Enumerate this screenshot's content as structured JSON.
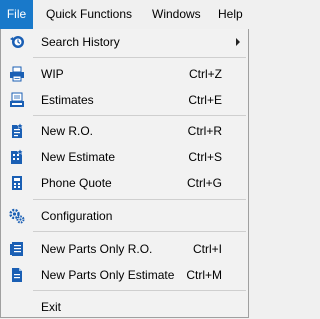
{
  "menubar": {
    "file": "File",
    "quick_functions": "Quick Functions",
    "windows": "Windows",
    "help": "Help"
  },
  "menu": {
    "search_history": {
      "label": "Search History",
      "icon": "history-icon"
    },
    "wip": {
      "label": "WIP",
      "shortcut": "Ctrl+Z",
      "icon": "printer-icon"
    },
    "estimates": {
      "label": "Estimates",
      "shortcut": "Ctrl+E",
      "icon": "calculator-icon"
    },
    "new_ro": {
      "label": "New R.O.",
      "shortcut": "Ctrl+R",
      "icon": "new-document-icon"
    },
    "new_estimate": {
      "label": "New Estimate",
      "shortcut": "Ctrl+S",
      "icon": "new-estimate-icon"
    },
    "phone_quote": {
      "label": "Phone Quote",
      "shortcut": "Ctrl+G",
      "icon": "phone-quote-icon"
    },
    "configuration": {
      "label": "Configuration",
      "icon": "gears-icon"
    },
    "new_parts_ro": {
      "label": "New Parts Only R.O.",
      "shortcut": "Ctrl+I",
      "icon": "parts-ro-icon"
    },
    "new_parts_estimate": {
      "label": "New Parts Only Estimate",
      "shortcut": "Ctrl+M",
      "icon": "parts-estimate-icon"
    },
    "exit": {
      "label": "Exit"
    }
  },
  "colors": {
    "active_menu_bg": "#1979ca",
    "icon_blue": "#1a5fb4"
  }
}
